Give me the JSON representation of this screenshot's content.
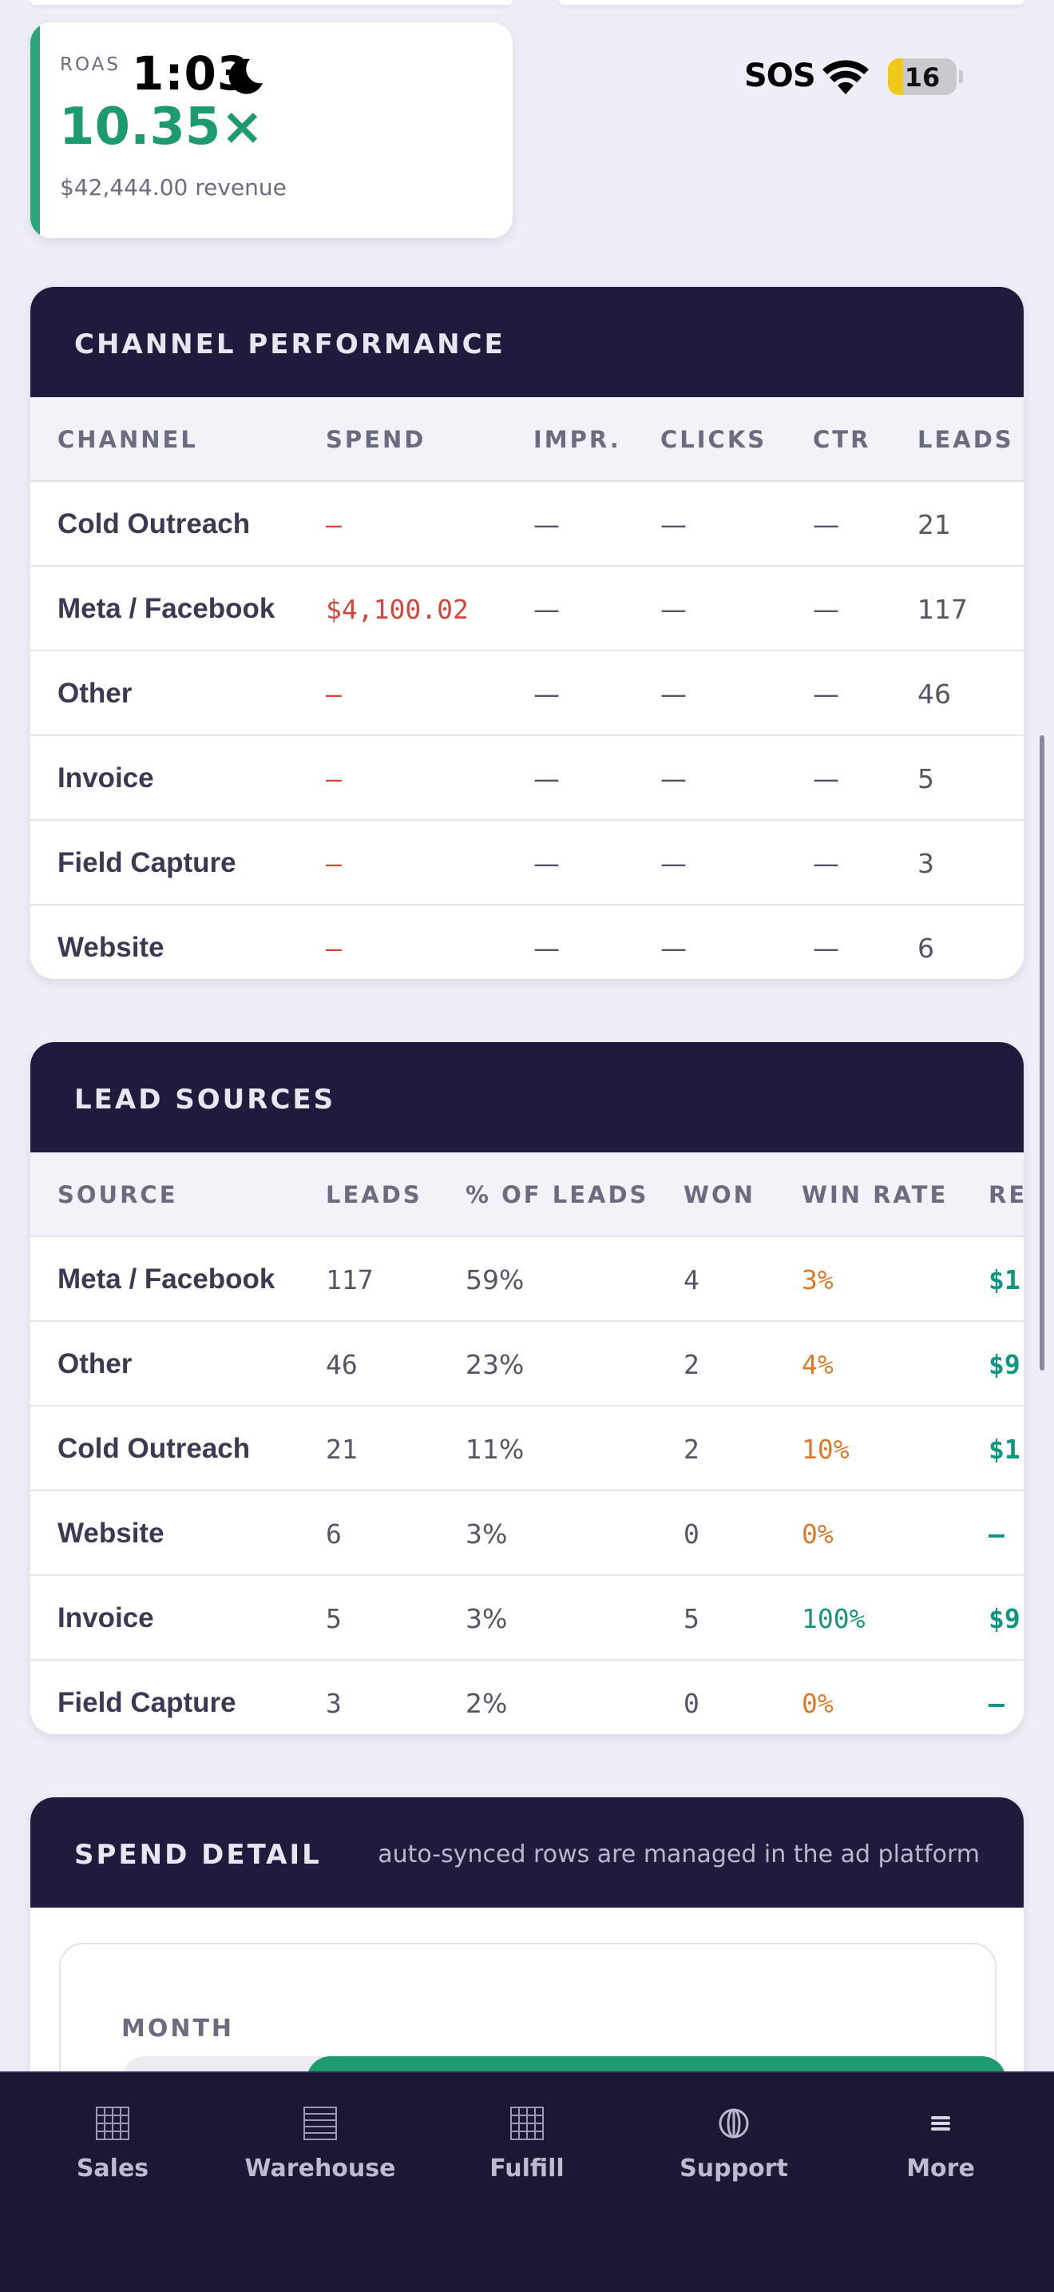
{
  "status_bar": {
    "time": "1:03",
    "carrier": "SOS",
    "battery": "16"
  },
  "roas_card": {
    "label": "ROAS",
    "value": "10.35×",
    "revenue": "$42,444.00 revenue",
    "accent_color": "#2aa57a"
  },
  "channel_performance": {
    "title": "CHANNEL PERFORMANCE",
    "columns": [
      "CHANNEL",
      "SPEND",
      "IMPR.",
      "CLICKS",
      "CTR",
      "LEADS"
    ],
    "rows": [
      {
        "channel": "Cold Outreach",
        "spend": "—",
        "impr": "—",
        "clicks": "—",
        "ctr": "—",
        "leads": "21"
      },
      {
        "channel": "Meta / Facebook",
        "spend": "$4,100.02",
        "impr": "—",
        "clicks": "—",
        "ctr": "—",
        "leads": "117"
      },
      {
        "channel": "Other",
        "spend": "—",
        "impr": "—",
        "clicks": "—",
        "ctr": "—",
        "leads": "46"
      },
      {
        "channel": "Invoice",
        "spend": "—",
        "impr": "—",
        "clicks": "—",
        "ctr": "—",
        "leads": "5"
      },
      {
        "channel": "Field Capture",
        "spend": "—",
        "impr": "—",
        "clicks": "—",
        "ctr": "—",
        "leads": "3"
      },
      {
        "channel": "Website",
        "spend": "—",
        "impr": "—",
        "clicks": "—",
        "ctr": "—",
        "leads": "6"
      }
    ]
  },
  "lead_sources": {
    "title": "LEAD SOURCES",
    "columns": [
      "SOURCE",
      "LEADS",
      "% OF LEADS",
      "WON",
      "WIN RATE",
      "RE"
    ],
    "rows": [
      {
        "source": "Meta / Facebook",
        "leads": "117",
        "pct": "59%",
        "won": "4",
        "win_rate": "3%",
        "revenue": "$1"
      },
      {
        "source": "Other",
        "leads": "46",
        "pct": "23%",
        "won": "2",
        "win_rate": "4%",
        "revenue": "$9"
      },
      {
        "source": "Cold Outreach",
        "leads": "21",
        "pct": "11%",
        "won": "2",
        "win_rate": "10%",
        "revenue": "$1"
      },
      {
        "source": "Website",
        "leads": "6",
        "pct": "3%",
        "won": "0",
        "win_rate": "0%",
        "revenue": "—"
      },
      {
        "source": "Invoice",
        "leads": "5",
        "pct": "3%",
        "won": "5",
        "win_rate": "100%",
        "revenue": "$9"
      },
      {
        "source": "Field Capture",
        "leads": "3",
        "pct": "2%",
        "won": "0",
        "win_rate": "0%",
        "revenue": "—"
      }
    ]
  },
  "spend_detail": {
    "title": "SPEND DETAIL",
    "note": "auto-synced rows are managed in the ad platform",
    "month_label": "MONTH"
  },
  "bottom_nav": {
    "items": [
      {
        "label": "Sales",
        "icon": "grid-icon"
      },
      {
        "label": "Warehouse",
        "icon": "list-icon"
      },
      {
        "label": "Fulfill",
        "icon": "grid-icon"
      },
      {
        "label": "Support",
        "icon": "globe-icon"
      },
      {
        "label": "More",
        "icon": "menu-icon"
      }
    ]
  }
}
